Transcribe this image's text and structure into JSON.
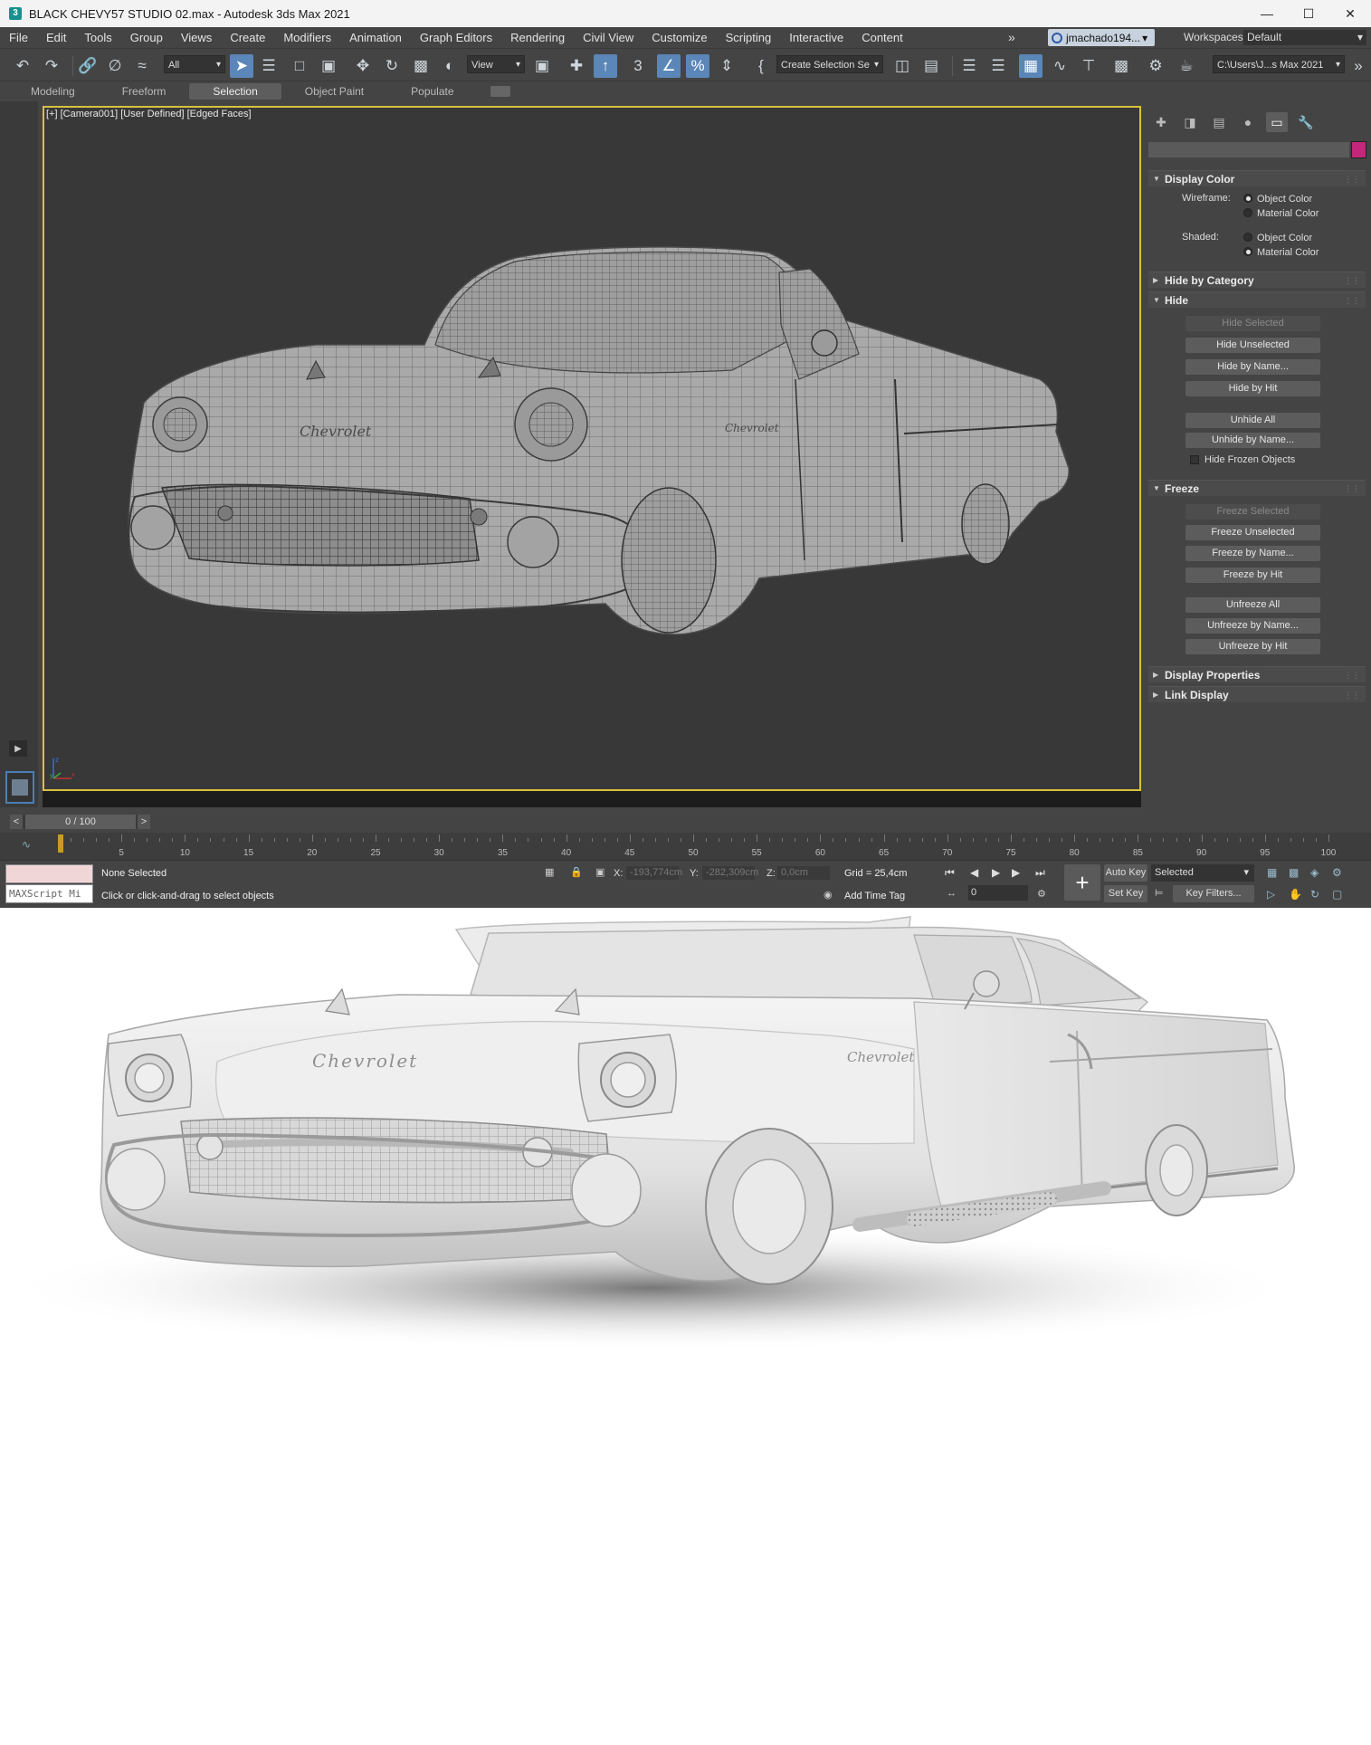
{
  "window": {
    "title": "BLACK CHEVY57 STUDIO 02.max - Autodesk 3ds Max 2021",
    "controls": [
      "minimize-icon",
      "maximize-icon",
      "close-icon"
    ]
  },
  "menu": {
    "items": [
      "File",
      "Edit",
      "Tools",
      "Group",
      "Views",
      "Create",
      "Modifiers",
      "Animation",
      "Graph Editors",
      "Rendering",
      "Civil View",
      "Customize",
      "Scripting",
      "Interactive",
      "Content"
    ],
    "more": "»",
    "user": "jmachado194...",
    "workspaces_label": "Workspaces:",
    "workspace": "Default"
  },
  "toolbar": {
    "filter": "All",
    "ref_coord": "View",
    "selection_set": "Create Selection Se",
    "project_path": "C:\\Users\\J...s Max 2021"
  },
  "ribbon": {
    "tabs": [
      "Modeling",
      "Freeform",
      "Selection",
      "Object Paint",
      "Populate"
    ],
    "active": "Selection"
  },
  "viewport": {
    "label": "[+] [Camera001] [User Defined] [Edged Faces]",
    "gizmo_axes": [
      "x",
      "y",
      "z"
    ]
  },
  "command_panel": {
    "tabs": [
      "create-icon",
      "modify-icon",
      "hierarchy-icon",
      "motion-icon",
      "display-icon",
      "utilities-icon"
    ],
    "active_tab": "display-icon",
    "object_color": "#c3267a",
    "display_color": {
      "title": "Display Color",
      "wireframe_label": "Wireframe:",
      "shaded_label": "Shaded:",
      "object_color": "Object Color",
      "material_color": "Material Color",
      "wireframe_selected": "Object Color",
      "shaded_selected": "Material Color"
    },
    "hide_by_category": "Hide by Category",
    "hide": {
      "title": "Hide",
      "hide_selected": "Hide Selected",
      "hide_unselected": "Hide Unselected",
      "hide_by_name": "Hide by Name...",
      "hide_by_hit": "Hide by Hit",
      "unhide_all": "Unhide All",
      "unhide_by_name": "Unhide by Name...",
      "hide_frozen": "Hide Frozen Objects"
    },
    "freeze": {
      "title": "Freeze",
      "freeze_selected": "Freeze Selected",
      "freeze_unselected": "Freeze Unselected",
      "freeze_by_name": "Freeze by Name...",
      "freeze_by_hit": "Freeze by Hit",
      "unfreeze_all": "Unfreeze All",
      "unfreeze_by_name": "Unfreeze by Name...",
      "unfreeze_by_hit": "Unfreeze by Hit"
    },
    "display_properties": "Display Properties",
    "link_display": "Link Display"
  },
  "timeline": {
    "prev": "<",
    "next": ">",
    "frame_display": "0 / 100",
    "ticks": [
      0,
      5,
      10,
      15,
      20,
      25,
      30,
      35,
      40,
      45,
      50,
      55,
      60,
      65,
      70,
      75,
      80,
      85,
      90,
      95,
      100
    ],
    "current_frame": 0
  },
  "status": {
    "maxscript": "MAXScript Mi",
    "selection": "None Selected",
    "prompt": "Click or click-and-drag to select objects",
    "x_label": "X:",
    "x_value": "-193,774cm",
    "y_label": "Y:",
    "y_value": "-282,309cm",
    "z_label": "Z:",
    "z_value": "0,0cm",
    "grid": "Grid = 25,4cm",
    "add_time_tag": "Add Time Tag",
    "frame": "0",
    "auto_key": "Auto Key",
    "set_key": "Set Key",
    "key_mode": "Selected",
    "key_filters": "Key Filters..."
  },
  "viewport_logo_text": "Chevrolet",
  "render_logo_text": "Chevrolet"
}
